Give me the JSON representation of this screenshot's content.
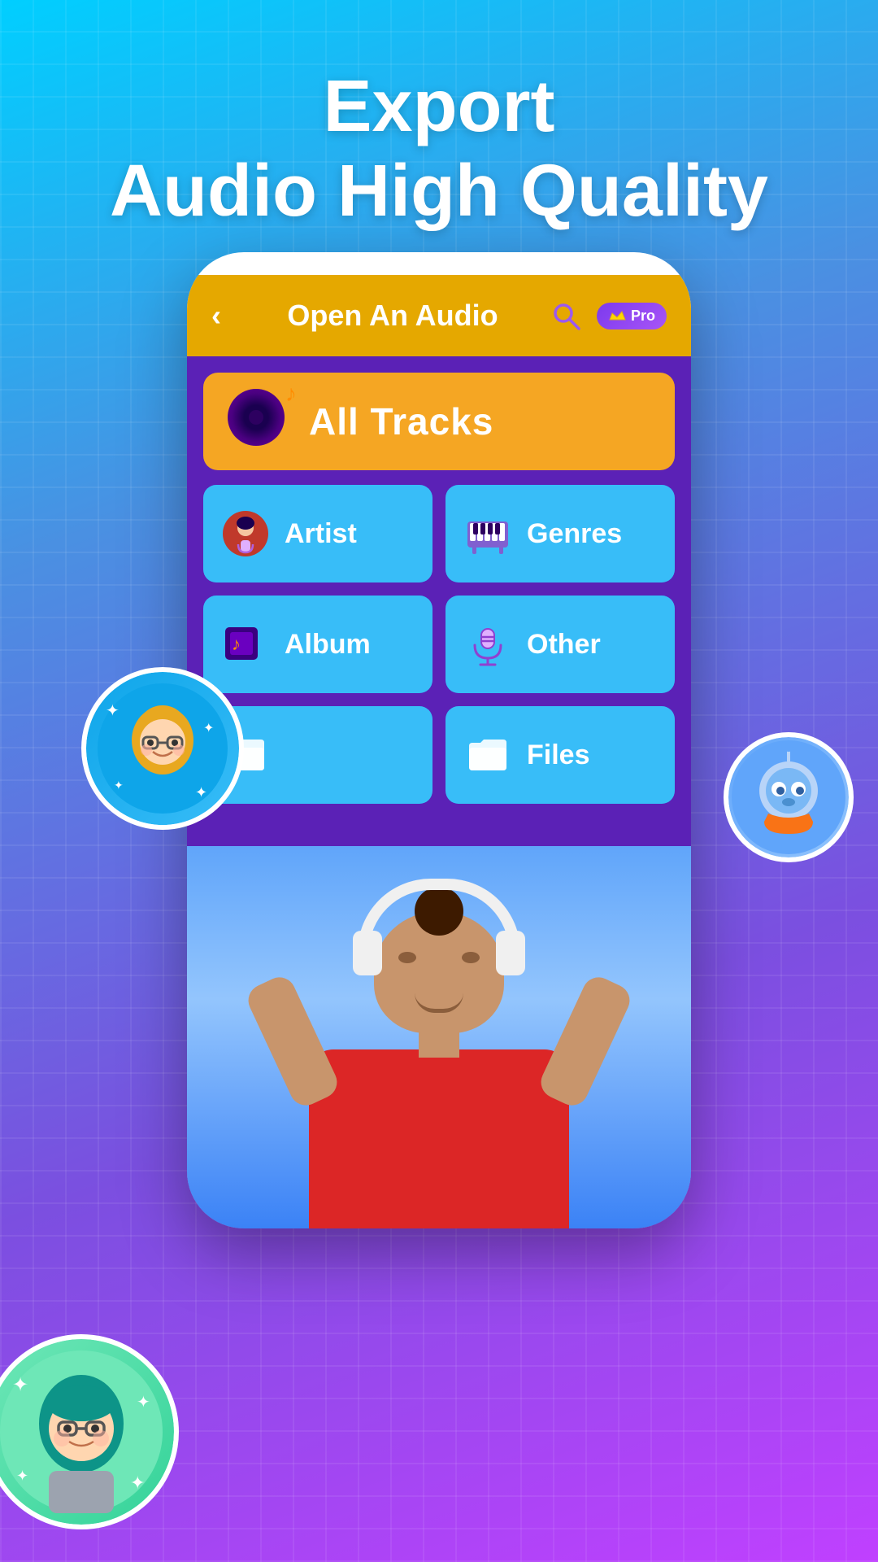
{
  "header": {
    "title_line1": "Export",
    "title_line2": "Audio High Quality"
  },
  "app": {
    "screen_title": "Open An Audio",
    "back_label": "‹",
    "search_icon": "search-icon",
    "pro_badge_label": "Pro",
    "all_tracks_label": "All Tracks",
    "menu_items": [
      {
        "id": "artist",
        "label": "Artist",
        "icon": "🎤"
      },
      {
        "id": "genres",
        "label": "Genres",
        "icon": "🎹"
      },
      {
        "id": "album",
        "label": "Album",
        "icon": "🎵"
      },
      {
        "id": "other",
        "label": "Other",
        "icon": "🎙"
      },
      {
        "id": "folder1",
        "label": "",
        "icon": "📁"
      },
      {
        "id": "files",
        "label": "Files",
        "icon": "📁"
      }
    ]
  },
  "colors": {
    "bg_gradient_start": "#00cfff",
    "bg_gradient_end": "#c040ff",
    "header_bar": "#e5a800",
    "app_bg": "#5b21b6",
    "all_tracks_bg": "#f5a623",
    "menu_item_bg": "#38bdf8",
    "accent_purple": "#7c3aed"
  }
}
